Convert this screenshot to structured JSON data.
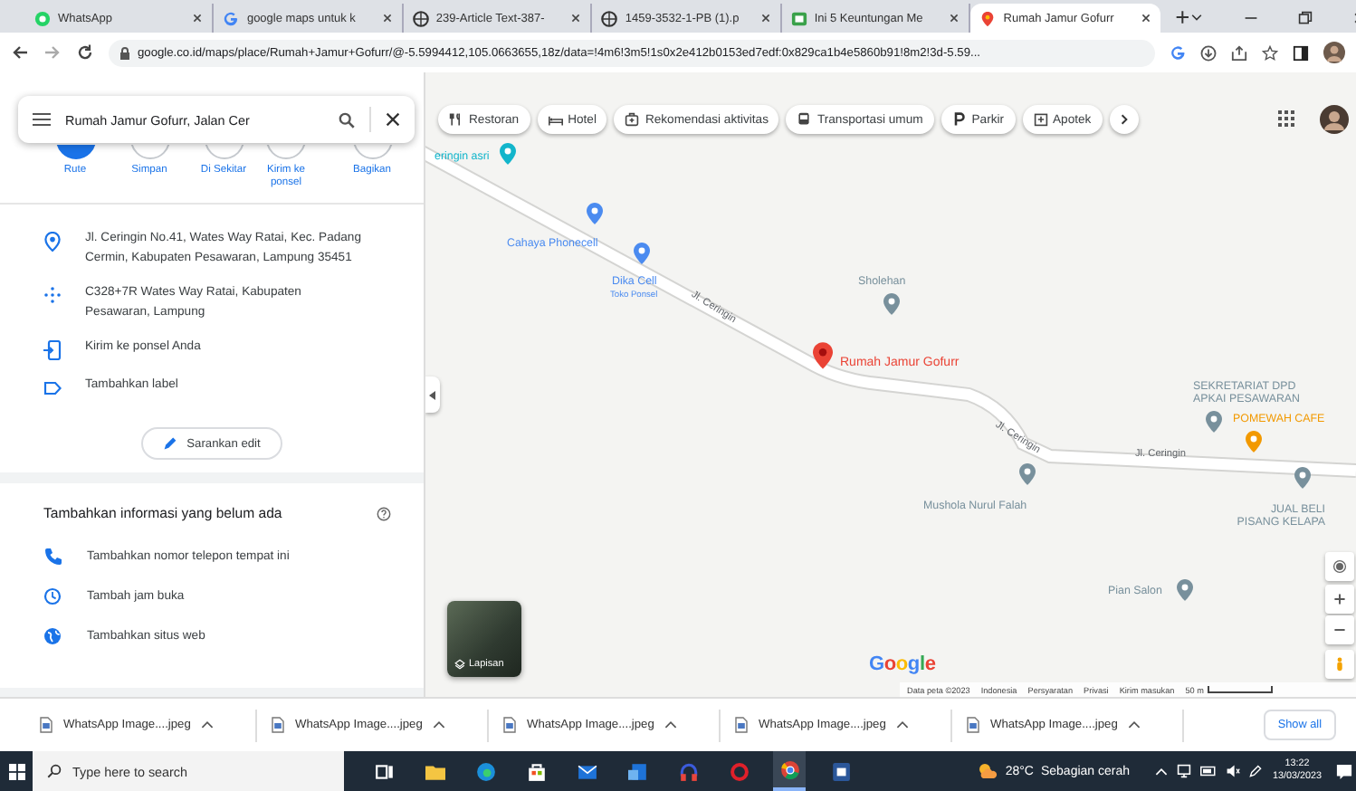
{
  "browser": {
    "tabs": [
      {
        "title": "WhatsApp",
        "selected": false
      },
      {
        "title": "google maps untuk k",
        "selected": false
      },
      {
        "title": "239-Article Text-387-",
        "selected": false
      },
      {
        "title": "1459-3532-1-PB (1).p",
        "selected": false
      },
      {
        "title": "Ini 5 Keuntungan Me",
        "selected": false
      },
      {
        "title": "Rumah Jamur Gofurr",
        "selected": true
      }
    ],
    "address": "google.co.id/maps/place/Rumah+Jamur+Gofurr/@-5.5994412,105.0663655,18z/data=!4m6!3m5!1s0x2e412b0153ed7edf:0x829ca1b4e5860b91!8m2!3d-5.59..."
  },
  "sidebar": {
    "search": "Rumah Jamur Gofurr, Jalan Cer",
    "actions": [
      {
        "label": "Rute",
        "primary": true
      },
      {
        "label": "Simpan",
        "primary": false
      },
      {
        "label": "Di Sekitar",
        "primary": false
      },
      {
        "label": "Kirim ke ponsel",
        "primary": false
      },
      {
        "label": "Bagikan",
        "primary": false
      }
    ],
    "details": [
      "Jl. Ceringin No.41, Wates Way Ratai, Kec. Padang Cermin, Kabupaten Pesawaran, Lampung 35451",
      "C328+7R Wates Way Ratai, Kabupaten Pesawaran, Lampung",
      "Kirim ke ponsel Anda",
      "Tambahkan label"
    ],
    "suggest_edit": "Sarankan edit",
    "add_info": {
      "title": "Tambahkan informasi yang belum ada",
      "items": [
        "Tambahkan nomor telepon tempat ini",
        "Tambah jam buka",
        "Tambahkan situs web"
      ]
    }
  },
  "map": {
    "chips": [
      "Restoran",
      "Hotel",
      "Rekomendasi aktivitas",
      "Transportasi umum",
      "Parkir",
      "Apotek"
    ],
    "places": [
      {
        "name": "eringin asri",
        "color": "#12b5cb",
        "selected": false
      },
      {
        "name": "Cahaya Phonecell",
        "color": "#4b8bf0",
        "selected": false
      },
      {
        "name": "Dika Cell",
        "subtitle": "Toko Ponsel",
        "color": "#4b8bf0",
        "selected": false
      },
      {
        "name": "Sholehan",
        "color": "#78909c",
        "selected": false
      },
      {
        "name": "Rumah Jamur Gofurr",
        "color": "#ea4335",
        "selected": true
      },
      {
        "name": "SEKRETARIAT DPD APKAI PESAWARAN",
        "color": "#78909c",
        "selected": false
      },
      {
        "name": "POMEWAH CAFE",
        "color": "#f29900",
        "selected": false
      },
      {
        "name": "Mushola Nurul Falah",
        "color": "#78909c",
        "selected": false
      },
      {
        "name": "JUAL BELI PISANG KELAPA",
        "color": "#78909c",
        "selected": false
      },
      {
        "name": "Pian Salon",
        "color": "#78909c",
        "selected": false
      }
    ],
    "streets": [
      "Jl. Ceringin",
      "Jl. Ceringin",
      "Jl. Ceringin"
    ],
    "layers": "Lapisan",
    "logo": "Google",
    "footer": [
      "Data peta ©2023",
      "Indonesia",
      "Persyaratan",
      "Privasi",
      "Kirim masukan"
    ],
    "scale": "50 m"
  },
  "downloads": {
    "items": [
      "WhatsApp Image....jpeg",
      "WhatsApp Image....jpeg",
      "WhatsApp Image....jpeg",
      "WhatsApp Image....jpeg",
      "WhatsApp Image....jpeg"
    ],
    "show_all": "Show all"
  },
  "taskbar": {
    "search_placeholder": "Type here to search",
    "temperature": "28°C",
    "weather": "Sebagian cerah",
    "time": "13:22",
    "date": "13/03/2023"
  }
}
